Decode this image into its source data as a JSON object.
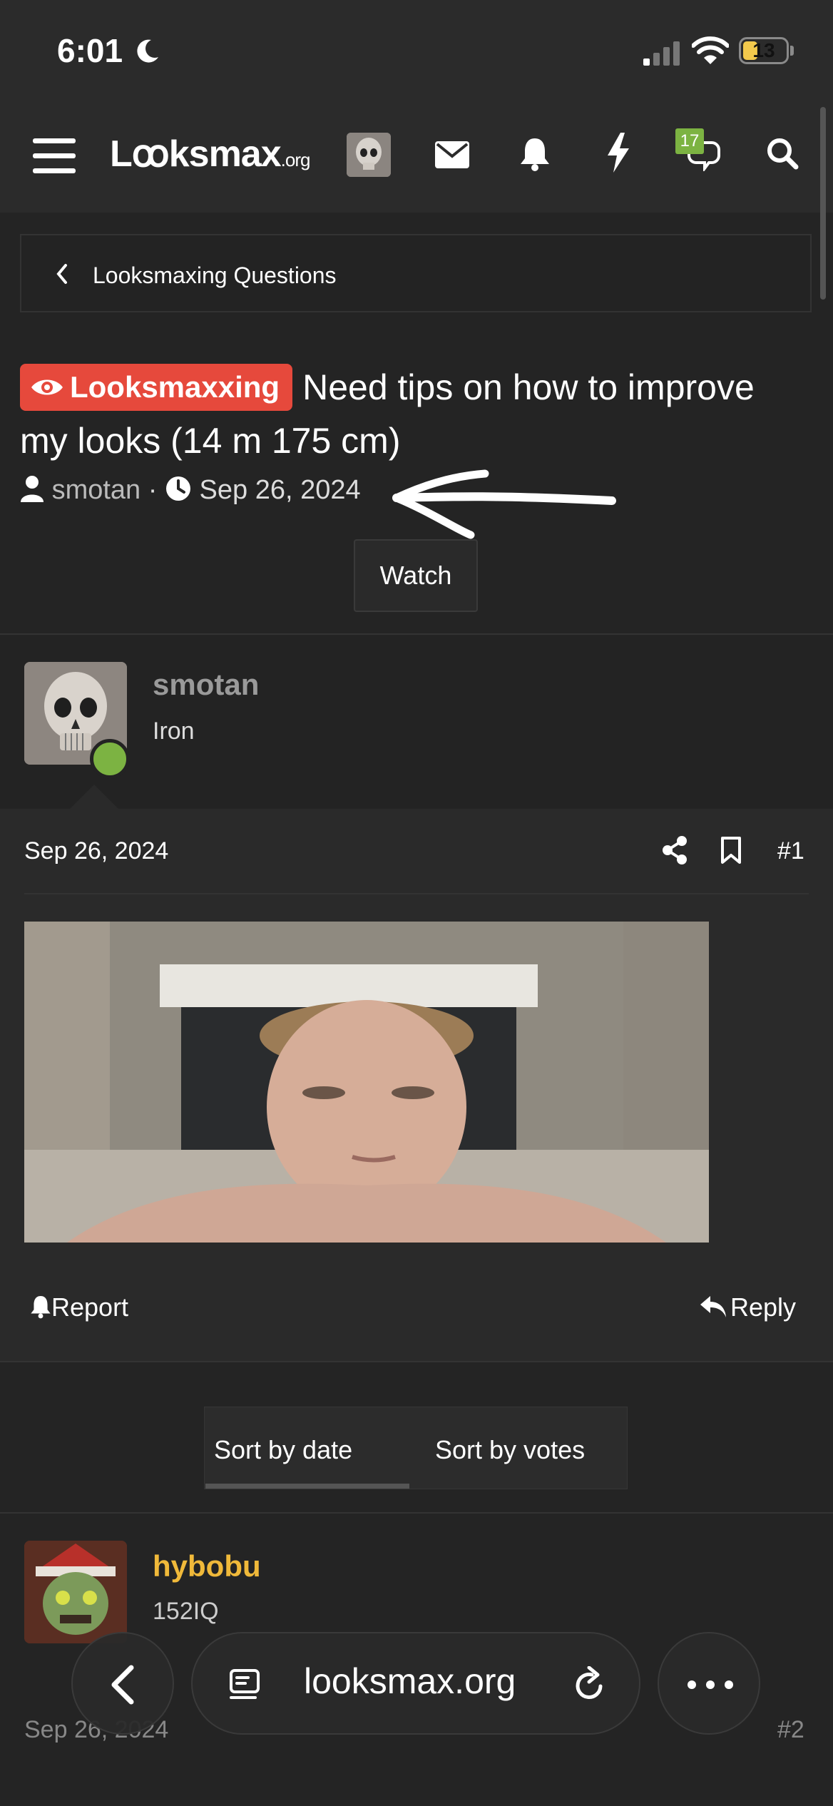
{
  "status_bar": {
    "time": "6:01",
    "battery": "13"
  },
  "nav": {
    "logo": "Lꝏksmax",
    "logo_suffix": ".org",
    "chat_badge": "17"
  },
  "breadcrumb": {
    "label": "Looksmaxing Questions"
  },
  "thread": {
    "prefix": "Looksmaxxing",
    "title": "Need tips on how to improve my looks (14 m 175 cm)",
    "author": "smotan",
    "separator": "·",
    "date": "Sep 26, 2024",
    "watch_label": "Watch"
  },
  "posts": [
    {
      "username": "smotan",
      "user_title": "Iron",
      "date": "Sep 26, 2024",
      "number": "#1",
      "report_label": "Report",
      "reply_label": "Reply"
    },
    {
      "username": "hybobu",
      "user_title": "152IQ",
      "date": "Sep 26, 2024",
      "number": "#2"
    }
  ],
  "sort": {
    "by_date": "Sort by date",
    "by_votes": "Sort by votes"
  },
  "browser": {
    "url": "looksmax.org"
  },
  "colors": {
    "prefix_red": "#e6493c",
    "online_green": "#7cb342",
    "username_gold": "#f0b93a",
    "background": "#242424"
  }
}
